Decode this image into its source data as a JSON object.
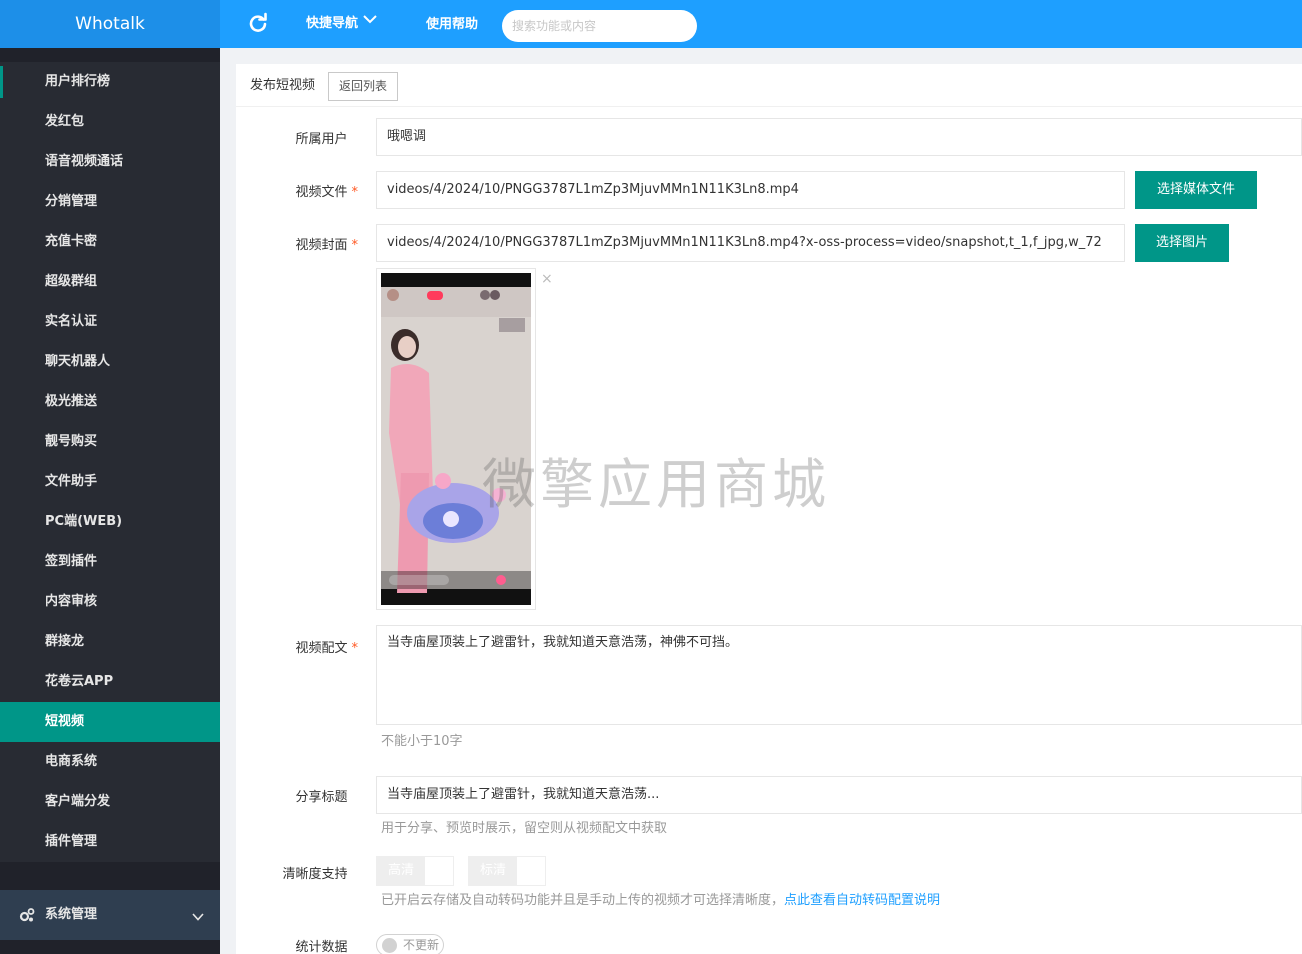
{
  "app": {
    "brand": "Whotalk"
  },
  "topbar": {
    "refresh_icon": "refresh-icon",
    "quick_nav": "快捷导航",
    "help": "使用帮助",
    "search_placeholder": "搜索功能或内容"
  },
  "sidebar": {
    "items": [
      {
        "label": "用户排行榜"
      },
      {
        "label": "发红包"
      },
      {
        "label": "语音视频通话"
      },
      {
        "label": "分销管理"
      },
      {
        "label": "充值卡密"
      },
      {
        "label": "超级群组"
      },
      {
        "label": "实名认证"
      },
      {
        "label": "聊天机器人"
      },
      {
        "label": "极光推送"
      },
      {
        "label": "靓号购买"
      },
      {
        "label": "文件助手"
      },
      {
        "label": "PC端(WEB)"
      },
      {
        "label": "签到插件"
      },
      {
        "label": "内容审核"
      },
      {
        "label": "群接龙"
      },
      {
        "label": "花卷云APP"
      },
      {
        "label": "短视频"
      },
      {
        "label": "电商系统"
      },
      {
        "label": "客户端分发"
      },
      {
        "label": "插件管理"
      }
    ],
    "active_index": 16,
    "system": {
      "label": "系统管理",
      "icon": "gears-icon"
    }
  },
  "page": {
    "title": "发布短视频",
    "back_button": "返回列表",
    "fields": {
      "owner": {
        "label": "所属用户",
        "value": "哦嗯调"
      },
      "video_file": {
        "label": "视频文件",
        "value": "videos/4/2024/10/PNGG3787L1mZp3MjuvMMn1N11K3Ln8.mp4",
        "button": "选择媒体文件"
      },
      "video_cover": {
        "label": "视频封面",
        "value": "videos/4/2024/10/PNGG3787L1mZp3MjuvMMn1N11K3Ln8.mp4?x-oss-process=video/snapshot,t_1,f_jpg,w_72",
        "button": "选择图片"
      },
      "caption": {
        "label": "视频配文",
        "value": "当寺庙屋顶装上了避雷针，我就知道天意浩荡，神佛不可挡。",
        "hint": "不能小于10字"
      },
      "share_title": {
        "label": "分享标题",
        "value": "当寺庙屋顶装上了避雷针，我就知道天意浩荡...",
        "hint": "用于分享、预览时展示，留空则从视频配文中获取"
      },
      "quality": {
        "label": "清晰度支持",
        "options": [
          "高清",
          "标清"
        ],
        "hint": "已开启云存储及自动转码功能并且是手动上传的视频才可选择清晰度，",
        "link": "点此查看自动转码配置说明"
      },
      "stats": {
        "label": "统计数据",
        "toggle_text": "不更新"
      }
    },
    "cover_close": "×"
  },
  "watermark": "微擎应用商城",
  "colors": {
    "topbar": "#1e9fff",
    "accent": "#009688",
    "sidebar": "#282b33"
  }
}
